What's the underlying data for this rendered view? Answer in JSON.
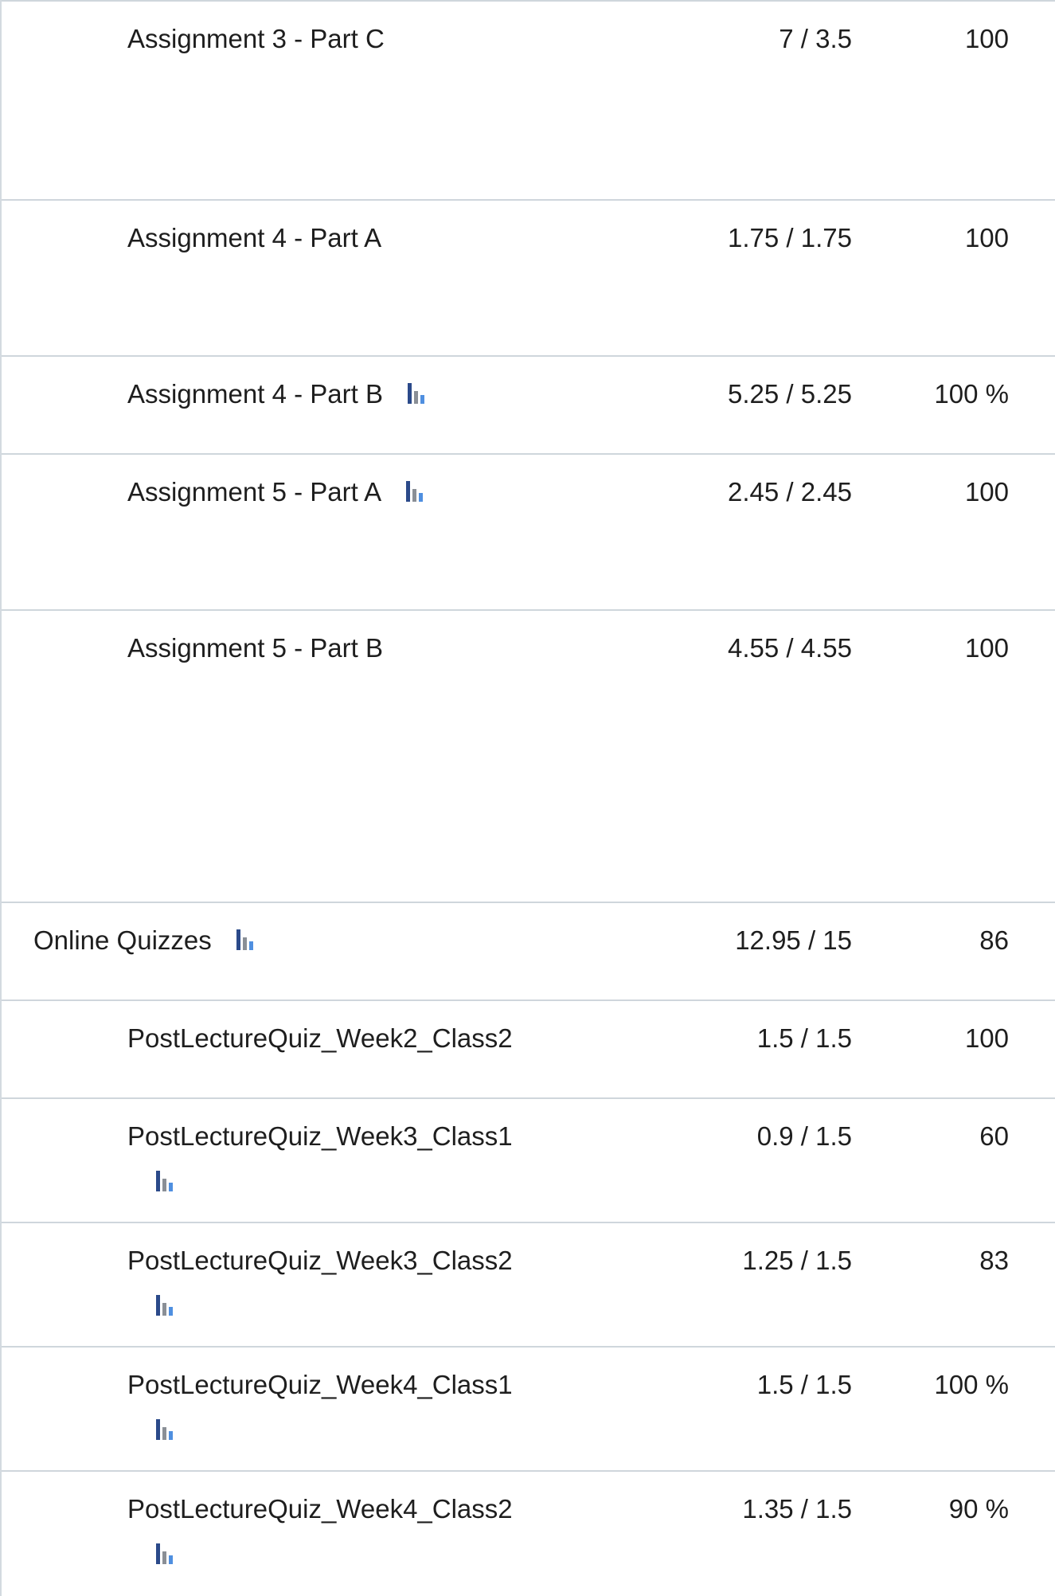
{
  "grade_rows": [
    {
      "name": "Assignment 3 - Part C",
      "points": "7 / 3.5",
      "weight": "100",
      "stats": false
    },
    {
      "name": "Assignment 4 - Part A",
      "points": "1.75 / 1.75",
      "weight": "100",
      "stats": false
    },
    {
      "name": "Assignment 4 - Part B",
      "points": "5.25 / 5.25",
      "weight": "100 %",
      "stats": true
    },
    {
      "name": "Assignment 5 - Part A",
      "points": "2.45 / 2.45",
      "weight": "100",
      "stats": true
    },
    {
      "name": "Assignment 5 - Part B",
      "points": "4.55 / 4.55",
      "weight": "100",
      "stats": false
    },
    {
      "name": "Online Quizzes",
      "points": "12.95 / 15",
      "weight": "86",
      "stats": true
    },
    {
      "name": "PostLectureQuiz_Week2_Class2",
      "points": "1.5 / 1.5",
      "weight": "100",
      "stats": false
    },
    {
      "name": "PostLectureQuiz_Week3_Class1",
      "points": "0.9 / 1.5",
      "weight": "60",
      "stats": true
    },
    {
      "name": "PostLectureQuiz_Week3_Class2",
      "points": "1.25 / 1.5",
      "weight": "83",
      "stats": true
    },
    {
      "name": "PostLectureQuiz_Week4_Class1",
      "points": "1.5 / 1.5",
      "weight": "100 %",
      "stats": true
    },
    {
      "name": "PostLectureQuiz_Week4_Class2",
      "points": "1.35 / 1.5",
      "weight": "90 %",
      "stats": true
    }
  ],
  "icons": {
    "stats": "bar-chart-icon"
  },
  "colors": {
    "row_border": "#cfd6dc",
    "text": "#1e1e1e",
    "stats_dark": "#2b4a8a",
    "stats_gray": "#8a8f96",
    "stats_light": "#4f8fe0"
  }
}
